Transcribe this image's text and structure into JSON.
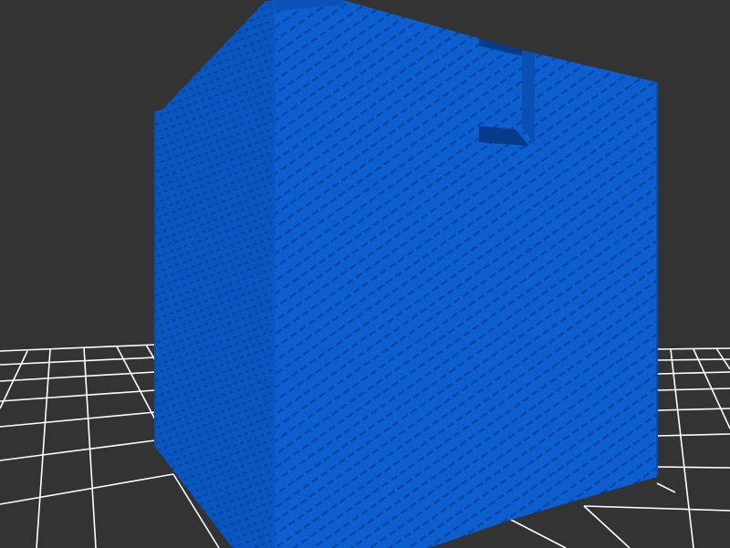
{
  "viewport": {
    "background_color": "#333333",
    "grid_color": "#ffffff"
  },
  "model": {
    "object": "perforated box",
    "color_left_face": "#0a56c0",
    "color_front_face": "#0d5fd0",
    "color_dark": "#063b8a",
    "color_hole": "#0846a2"
  }
}
